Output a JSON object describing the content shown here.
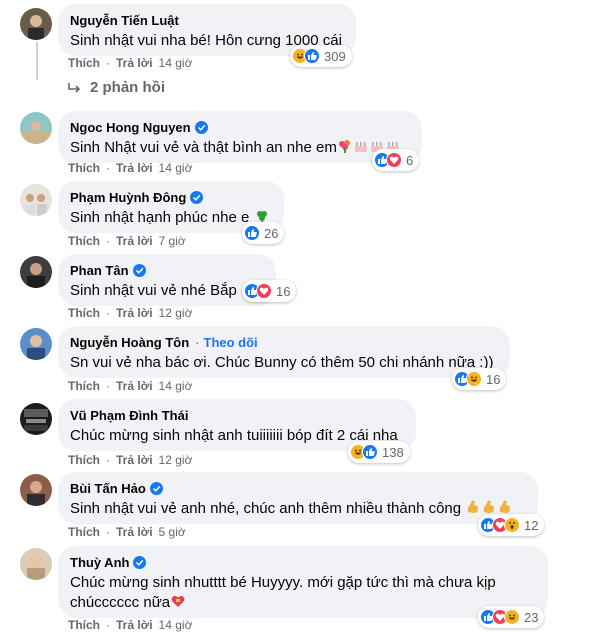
{
  "labels": {
    "like": "Thích",
    "reply": "Trả lời",
    "follow": "Theo dõi",
    "separator": "·"
  },
  "comments": [
    {
      "name": "Nguyễn Tiến Luật",
      "verified": false,
      "text": "Sinh nhật vui nha bé! Hôn cưng 1000 cái",
      "time": "14 giờ",
      "count": "309",
      "reactions": [
        "haha",
        "like"
      ],
      "replies": "2 phản hồi"
    },
    {
      "name": "Ngoc Hong Nguyen",
      "verified": true,
      "text": "Sinh Nhật vui vẻ và thật bình an nhe em",
      "emojis": [
        "bouquet-icon",
        "cake-icon",
        "cake-icon",
        "cake-icon"
      ],
      "time": "14 giờ",
      "count": "6",
      "reactions": [
        "like",
        "love"
      ]
    },
    {
      "name": "Phạm Huỳnh Đông",
      "verified": true,
      "text": "Sinh nhật hạnh phúc nhe e",
      "emojis": [
        "clover-icon"
      ],
      "time": "7 giờ",
      "count": "26",
      "reactions": [
        "like"
      ]
    },
    {
      "name": "Phan Tân",
      "verified": true,
      "text": "Sinh nhật vui vẻ nhé Bắp",
      "time": "12 giờ",
      "count": "16",
      "reactions": [
        "like",
        "love"
      ]
    },
    {
      "name": "Nguyễn Hoàng Tôn",
      "verified": false,
      "follow": true,
      "text": "Sn vui vẻ nha bác ơi. Chúc Bunny có thêm 50 chi nhánh nữa :))",
      "time": "14 giờ",
      "count": "16",
      "reactions": [
        "like",
        "haha"
      ]
    },
    {
      "name": "Vũ Phạm Đình Thái",
      "verified": false,
      "text": "Chúc mừng sinh nhật anh tuiiiiiii bóp đít 2 cái nha",
      "time": "12 giờ",
      "count": "138",
      "reactions": [
        "haha",
        "like"
      ]
    },
    {
      "name": "Bùi Tấn Hảo",
      "verified": true,
      "text": "Sinh nhật vui vẻ anh nhé, chúc anh thêm nhiều thành công",
      "emojis": [
        "muscle-icon",
        "muscle-icon",
        "muscle-icon"
      ],
      "time": "5 giờ",
      "count": "12",
      "reactions": [
        "like",
        "love",
        "wow"
      ]
    },
    {
      "name": "Thuỳ Anh",
      "verified": true,
      "text": "Chúc mừng sinh nhutttt bé Huyyyy. mới gặp tức thì mà chưa kịp",
      "text2": "chúcccccc nữa",
      "emojis": [
        "heart-ribbon-icon"
      ],
      "time": "14 giờ",
      "count": "23",
      "reactions": [
        "like",
        "love",
        "haha"
      ]
    }
  ],
  "colors": {
    "like": "#1877f2",
    "love": "#f33e58",
    "haha": "#f7b125",
    "bubble": "#f0f2f5",
    "meta": "#65676b"
  }
}
